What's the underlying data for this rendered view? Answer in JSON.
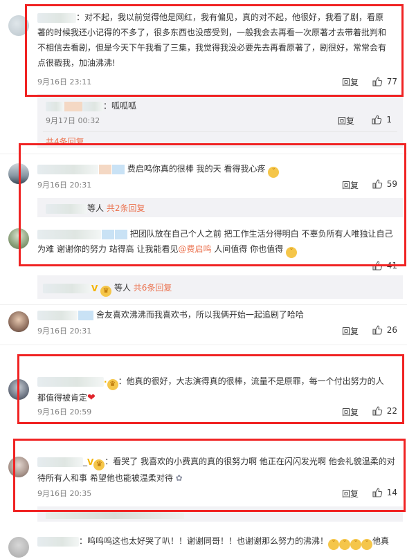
{
  "comments": [
    {
      "text": "：对不起，我以前觉得他是网红，我有偏见，真的对不起，他很好，我看了剧，看原著的时候我还小记得的不多了，很多东西也没感受到，一般我会去再看一次原著才去带着批判和不相信去看剧，但是今天下午我看了三集，我觉得我没必要先去再看原著了，剧很好，常常会有点很戳我，加油沸沸!",
      "time": "9月16日 23:11",
      "reply": "回复",
      "likes": "77"
    },
    {
      "text": "费启鸣你真的很棒 我的天 看得我心疼",
      "time": "9月16日 20:31",
      "reply": "回复",
      "likes": "59"
    },
    {
      "text_a": "把团队放在自己个人之前 把工作生活分得明白  不辜负所有人唯独让自己为难 谢谢你的努力 站得高 让我能看见",
      "mention": "@费启鸣",
      "text_b": " 人间值得 你也值得",
      "likes": "41"
    },
    {
      "text": "舍友喜欢沸沸而我喜欢书，所以我俩开始一起追剧了哈哈",
      "time": "9月16日 20:31",
      "reply": "回复",
      "likes": "26"
    },
    {
      "text": "：他真的很好，大志演得真的很棒，流量不是原罪，每一个付出努力的人都值得被肯定",
      "time": "9月16日 20:59",
      "reply": "回复",
      "likes": "22"
    },
    {
      "text": "：看哭了 我喜欢的小费真的真的很努力啊 他正在闪闪发光啊 他会礼貌温柔的对待所有人和事 希望他也能被温柔对待",
      "time": "9月16日 20:35",
      "reply": "回复",
      "likes": "14"
    },
    {
      "text": "：呜呜呜这也太好哭了叭！！谢谢同哥！！也谢谢那么努力的沸沸！",
      "suffix": "他真"
    }
  ],
  "subreplies": [
    {
      "text": "：呱呱呱",
      "time": "9月17日 00:32",
      "reply": "回复",
      "likes": "1"
    }
  ],
  "threads": [
    {
      "label": "共4条回复"
    },
    {
      "prefix": "等人",
      "label": "共2条回复"
    },
    {
      "prefix": "等人",
      "label": "共6条回复"
    }
  ],
  "colors": {
    "accent": "#eb7350",
    "highlight_box": "#f02323"
  }
}
